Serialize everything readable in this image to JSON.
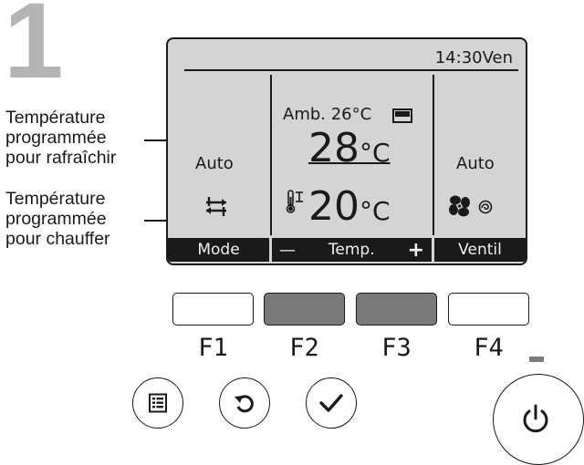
{
  "step": {
    "number": "1"
  },
  "annotations": {
    "cool_label": [
      "Température",
      "programmée",
      "pour rafraîchir"
    ],
    "heat_label": [
      "Température",
      "programmée",
      "pour chauffer"
    ]
  },
  "lcd": {
    "clock": "14:30Ven",
    "left": {
      "mode_text": "Auto"
    },
    "center": {
      "ambient_label": "Amb.",
      "ambient_value": "26°C",
      "cool_setpoint": "28",
      "heat_setpoint": "20",
      "unit": "°C"
    },
    "right": {
      "fan_text": "Auto"
    },
    "function_bar": {
      "f1": "Mode",
      "f2_minus": "—",
      "temp": "Temp.",
      "f3_plus": "+",
      "f4": "Ventil"
    }
  },
  "function_keys": [
    "F1",
    "F2",
    "F3",
    "F4"
  ],
  "buttons": {
    "menu": "menu-icon",
    "back": "back-icon",
    "confirm": "check-icon",
    "power": "power-icon"
  },
  "colors": {
    "lcd_background": "#d4d4d4",
    "highlighted_key": "#7a7a7a",
    "step_number": "#b4b4b4"
  }
}
